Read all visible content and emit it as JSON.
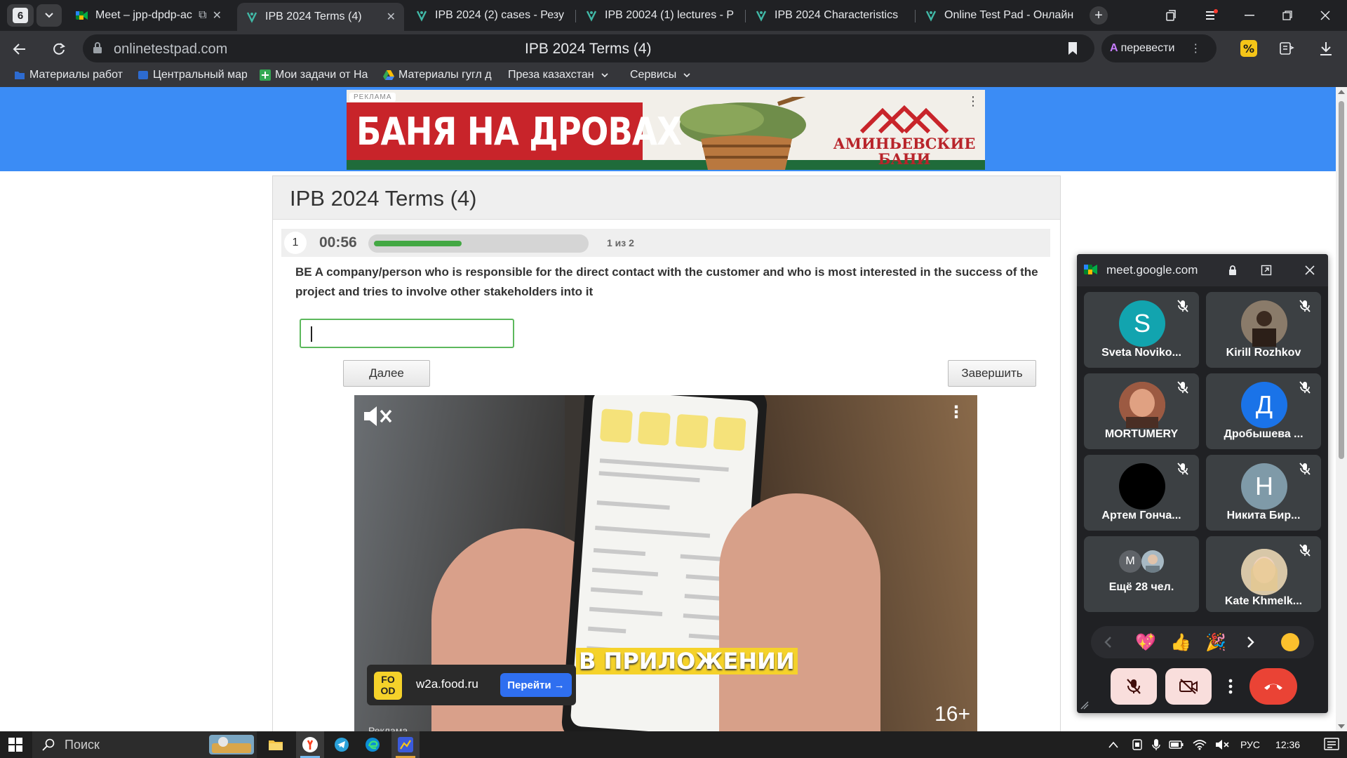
{
  "browser": {
    "tab_count": "6",
    "tabs": [
      {
        "title": "Meet – jpp-dpdp-ac",
        "icon": "google-meet-icon"
      },
      {
        "title": "IPB 2024 Terms (4)",
        "icon": "onlinetestpad-icon",
        "active": true
      },
      {
        "title": "IPB 2024 (2) cases - Резу",
        "icon": "onlinetestpad-icon"
      },
      {
        "title": "IPB 20024 (1) lectures - Р",
        "icon": "onlinetestpad-icon"
      },
      {
        "title": "IPB 2024 Characteristics",
        "icon": "onlinetestpad-icon"
      },
      {
        "title": "Online Test Pad - Онлайн",
        "icon": "onlinetestpad-icon"
      }
    ],
    "url": "onlinetestpad.com",
    "page_title": "IPB 2024 Terms (4)",
    "translate_label": "перевести",
    "bookmarks": [
      {
        "label": "Материалы работ",
        "icon": "folder-icon",
        "color": "#2d6bd0"
      },
      {
        "label": "Центральный мар",
        "icon": "bookmark-icon",
        "color": "#2d6bd0"
      },
      {
        "label": "Мои задачи от На",
        "icon": "plus-icon",
        "color": "#34a853"
      },
      {
        "label": "Материалы гугл д",
        "icon": "google-drive-icon",
        "color": "#fbbc04"
      },
      {
        "label": "Преза казахстан",
        "icon": "chevron-down-icon"
      },
      {
        "label": "Сервисы",
        "icon": "chevron-down-icon"
      }
    ]
  },
  "ad_banner": {
    "label": "РЕКЛАМА",
    "headline": "БАНЯ НА ДРОВАХ",
    "brand": "АМИНЬЕВСКИЕ БАНИ",
    "brand_lines": [
      "АМИНЬЕВСКИЕ",
      "БАНИ"
    ]
  },
  "test": {
    "title": "IPB 2024 Terms (4)",
    "question_number": "1",
    "timer": "00:56",
    "progress_fraction": 0.5,
    "counter": "1 из 2",
    "question": "BE A company/person who is responsible for the direct contact with the customer and who is most interested in the success of the project and tries to involve other stakeholders into it",
    "answer_value": "",
    "next_label": "Далее",
    "finish_label": "Завершить"
  },
  "video_ad": {
    "caption": "В ПРИЛОЖЕНИИ",
    "logo_text": "FO OD",
    "domain": "w2a.food.ru",
    "cta": "Перейти →",
    "age": "16+",
    "ad_label": "Реклама"
  },
  "meet": {
    "site": "meet.google.com",
    "participants": [
      {
        "name": "Sveta Noviko...",
        "initial": "S",
        "avatar_color": "#12a4af",
        "muted": true
      },
      {
        "name": "Kirill Rozhkov",
        "initial": "",
        "avatar_color": "#6b4f3a",
        "muted": true,
        "photo": true
      },
      {
        "name": "MORTUMERY",
        "initial": "",
        "avatar_color": "#c57a5e",
        "muted": true,
        "photo": true
      },
      {
        "name": "Дробышева ...",
        "initial": "Д",
        "avatar_color": "#1a73e8",
        "muted": true
      },
      {
        "name": "Артем Гонча...",
        "initial": "",
        "avatar_color": "#000000",
        "muted": true
      },
      {
        "name": "Никита Бир...",
        "initial": "Н",
        "avatar_color": "#7f9aa8",
        "muted": true
      },
      {
        "name": "Ещё 28 чел.",
        "initial": "M",
        "avatar_color": "#5f6368",
        "muted": false,
        "more": true
      },
      {
        "name": "Kate Khmelk...",
        "initial": "",
        "avatar_color": "#c9b28a",
        "muted": true,
        "photo": true
      }
    ],
    "reactions": [
      "💖",
      "👍",
      "🎉"
    ]
  },
  "taskbar": {
    "search_placeholder": "Поиск",
    "language": "РУС",
    "time": "12:36"
  }
}
